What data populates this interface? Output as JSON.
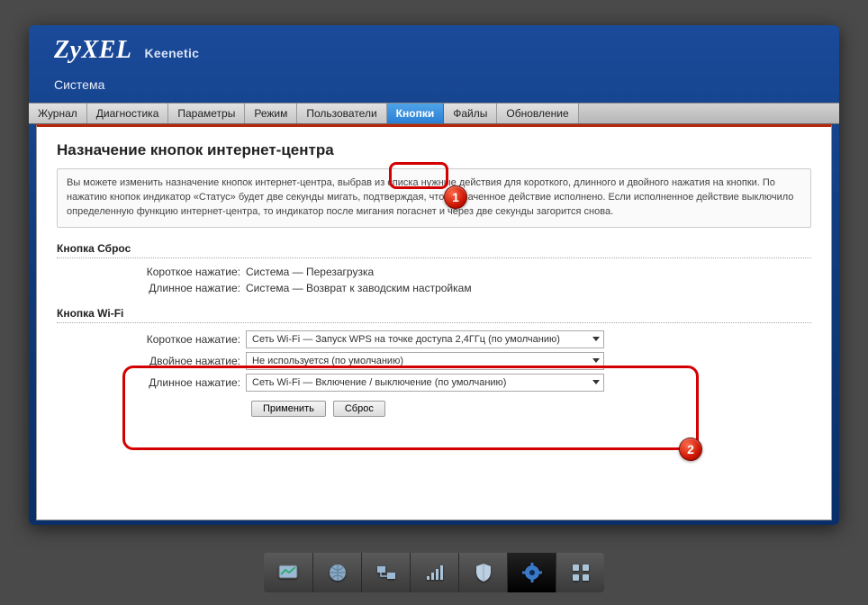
{
  "brand": {
    "logo": "ZyXEL",
    "product": "Keenetic"
  },
  "section": "Система",
  "tabs": [
    "Журнал",
    "Диагностика",
    "Параметры",
    "Режим",
    "Пользователи",
    "Кнопки",
    "Файлы",
    "Обновление"
  ],
  "active_tab": "Кнопки",
  "page": {
    "title": "Назначение кнопок интернет-центра",
    "description": "Вы можете изменить назначение кнопок интернет-центра, выбрав из списка нужные действия для короткого, длинного и двойного нажатия на кнопки. По нажатию кнопок индикатор «Статус» будет две секунды мигать, подтверждая, что назначенное действие исполнено. Если исполненное действие выключило определенную функцию интернет-центра, то индикатор после мигания погаснет и через две секунды загорится снова."
  },
  "groups": {
    "reset": {
      "title": "Кнопка Сброс",
      "rows": {
        "short": {
          "label": "Короткое нажатие:",
          "value": "Система — Перезагрузка"
        },
        "long": {
          "label": "Длинное нажатие:",
          "value": "Система — Возврат к заводским настройкам"
        }
      }
    },
    "wifi": {
      "title": "Кнопка Wi-Fi",
      "rows": {
        "short": {
          "label": "Короткое нажатие:",
          "value": "Сеть Wi-Fi — Запуск WPS на точке доступа 2,4ГГц (по умолчанию)"
        },
        "double": {
          "label": "Двойное нажатие:",
          "value": "Не используется (по умолчанию)"
        },
        "long": {
          "label": "Длинное нажатие:",
          "value": "Сеть Wi-Fi — Включение / выключение (по умолчанию)"
        }
      }
    }
  },
  "buttons": {
    "apply": "Применить",
    "reset": "Сброс"
  },
  "annotations": {
    "tab_badge": "1",
    "body_badge": "2"
  }
}
